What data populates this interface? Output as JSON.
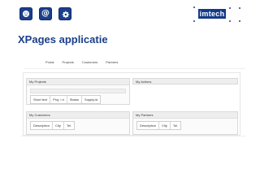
{
  "header": {
    "icons": [
      "profile-icon",
      "mail-icon",
      "gear-icon"
    ],
    "mail_glyph": "@",
    "logo_text": "imtech"
  },
  "page": {
    "title": "XPages applicatie"
  },
  "nav": {
    "items": [
      "Portal",
      "Projects",
      "Customers",
      "Partners"
    ]
  },
  "panels": {
    "projects": {
      "title": "My Projects",
      "columns": [
        "Short text",
        "Proj. i d",
        "Status",
        "Supply.id"
      ]
    },
    "actions": {
      "title": "My Actions"
    },
    "customers": {
      "title": "My Customers",
      "columns": [
        "Description",
        "City",
        "Tel."
      ]
    },
    "partners": {
      "title": "My Partners",
      "columns": [
        "Description",
        "City",
        "Tel."
      ]
    }
  },
  "colors": {
    "brand": "#1b3f8b",
    "panel_header": "#eeeeee"
  }
}
